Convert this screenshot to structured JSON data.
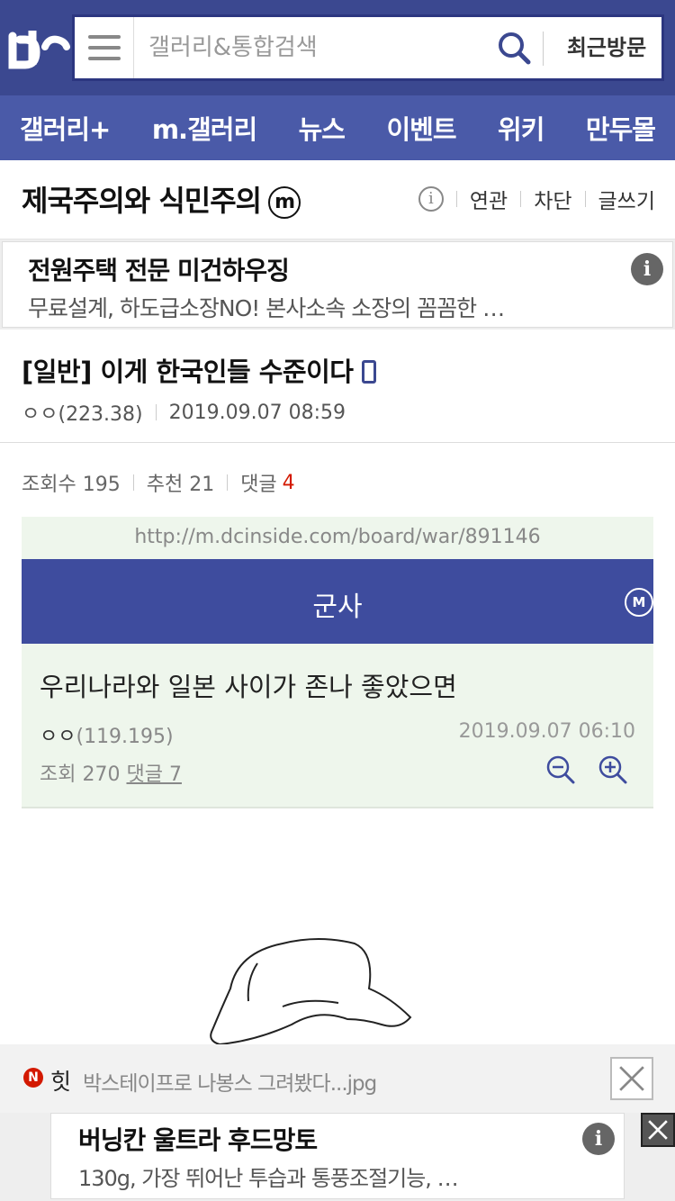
{
  "header": {
    "search_placeholder": "갤러리&통합검색",
    "recent_label": "최근방문"
  },
  "nav": {
    "items": [
      {
        "label": "갤러리+"
      },
      {
        "label": "m.갤러리"
      },
      {
        "label": "뉴스"
      },
      {
        "label": "이벤트"
      },
      {
        "label": "위키"
      },
      {
        "label": "만두몰"
      }
    ]
  },
  "gallery": {
    "title": "제국주의와 식민주의",
    "badge": "m",
    "info_icon": "i",
    "tools": [
      "연관",
      "차단",
      "글쓰기"
    ]
  },
  "ad_top": {
    "title": "전원주택 전문 미건하우징",
    "desc": "무료설계, 하도급소장NO! 본사소속 소장의 꼼꼼한 …",
    "info_icon": "i"
  },
  "post": {
    "title": "[일반] 이게 한국인들 수준이다",
    "author": "ㅇㅇ(223.38)",
    "date": "2019.09.07 08:59"
  },
  "stats": {
    "views_label": "조회수 195",
    "recommend_label": "추천 21",
    "comments_label": "댓글",
    "comments_count": "4"
  },
  "embed": {
    "url": "http://m.dcinside.com/board/war/891146",
    "bar_title": "군사",
    "badge": "M",
    "post_title": "우리나라와 일본 사이가 존나 좋았으면",
    "author_name": "ㅇㅇ",
    "author_ip": "(119.195)",
    "date": "2019.09.07 06:10",
    "views": "조회 270",
    "comments": "댓글 7"
  },
  "hit": {
    "badge": "N",
    "label": "힛",
    "text": "박스테이프로 나봉스 그려봤다...jpg"
  },
  "ad_bottom": {
    "title": "버닝칸 울트라 후드망토",
    "desc": "130g, 가장 뛰어난 투습과 통풍조절기능, …",
    "info_icon": "i"
  },
  "colors": {
    "header_bg": "#3b4890",
    "nav_bg": "#4a5aa8",
    "accent_red": "#d31900"
  }
}
